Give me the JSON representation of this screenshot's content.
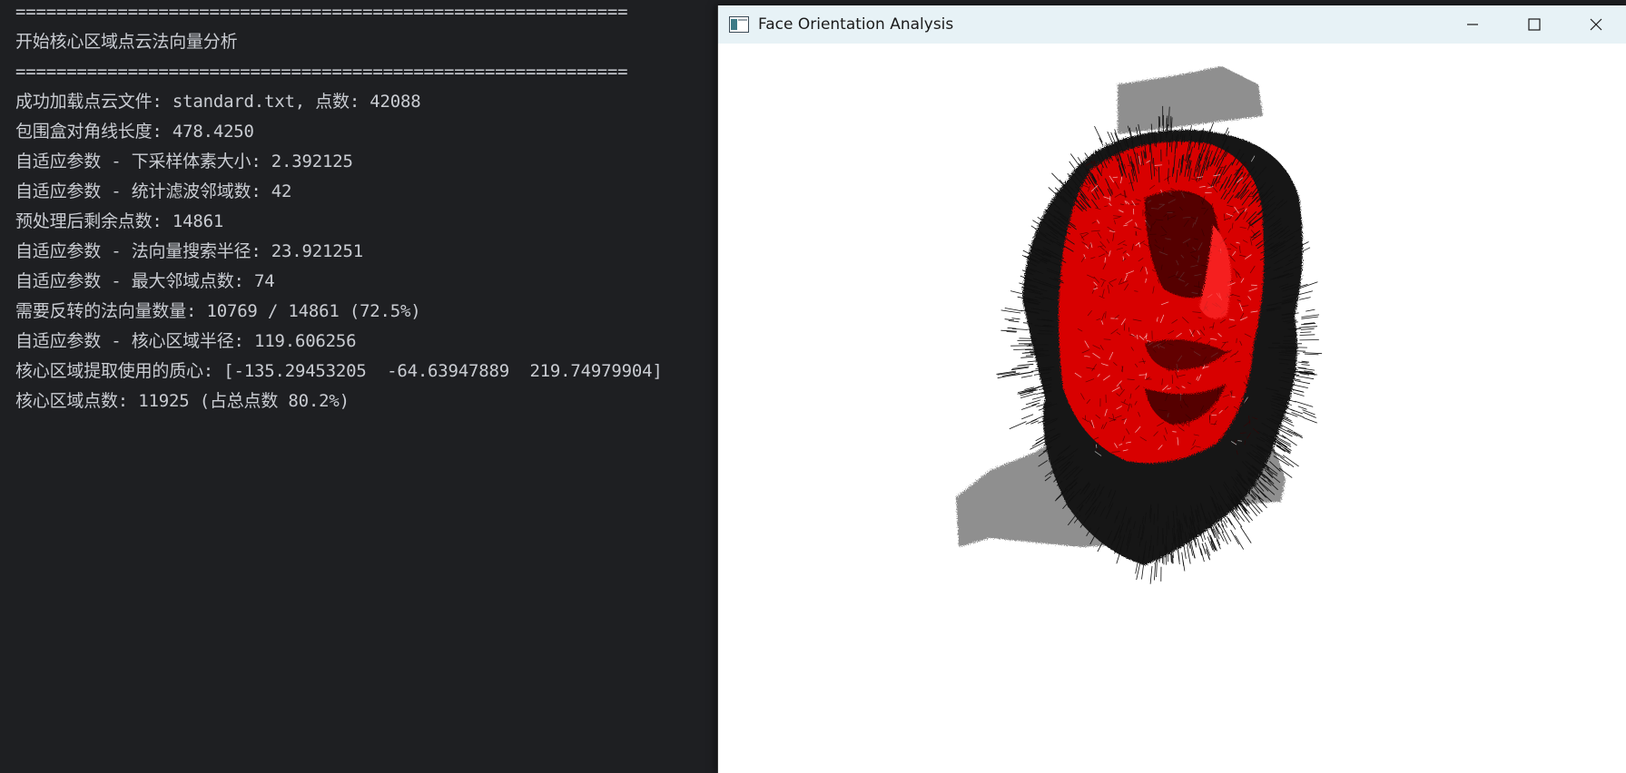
{
  "terminal": {
    "lines": [
      "============================================================",
      "开始核心区域点云法向量分析",
      "============================================================",
      "成功加载点云文件: standard.txt, 点数: 42088",
      "包围盒对角线长度: 478.4250",
      "自适应参数 - 下采样体素大小: 2.392125",
      "自适应参数 - 统计滤波邻域数: 42",
      "预处理后剩余点数: 14861",
      "自适应参数 - 法向量搜索半径: 23.921251",
      "自适应参数 - 最大邻域点数: 74",
      "需要反转的法向量数量: 10769 / 14861 (72.5%)",
      "自适应参数 - 核心区域半径: 119.606256",
      "核心区域提取使用的质心: [-135.29453205  -64.63947889  219.74979904]",
      "核心区域点数: 11925 (占总点数 80.2%)"
    ]
  },
  "window": {
    "title": "Face Orientation Analysis",
    "icons": {
      "app": "app-window-icon",
      "minimize": "minimize-icon",
      "maximize": "maximize-icon",
      "close": "close-icon"
    },
    "colors": {
      "titlebar": "#e7f2f6",
      "background_points": "#8c8c8c",
      "normals": "#141414",
      "core_region": "#e00000"
    }
  }
}
